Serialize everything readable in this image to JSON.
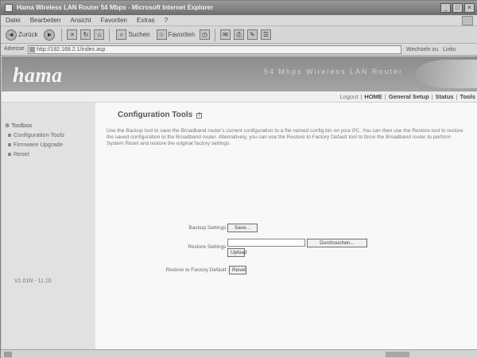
{
  "window": {
    "title": "Hama Wireless LAN Router 54 Mbps - Microsoft Internet Explorer",
    "controls": [
      "_",
      "□",
      "×"
    ]
  },
  "menu": [
    "Datei",
    "Bearbeiten",
    "Ansicht",
    "Favoriten",
    "Extras",
    "?"
  ],
  "toolbar": {
    "back_label": "Zurück",
    "search_label": "Suchen",
    "favorites_label": "Favoriten"
  },
  "address": {
    "label": "Adresse",
    "url": "http://192.168.2.1/index.asp",
    "go_label": "Wechseln zu",
    "links_label": "Links"
  },
  "banner": {
    "logo": "hama",
    "tagline": "54 Mbps Wireless LAN Router"
  },
  "topnav": {
    "logout": "Logout",
    "items": [
      "HOME",
      "General Setup",
      "Status",
      "Tools"
    ]
  },
  "sidebar": {
    "root": "Toolbox",
    "items": [
      {
        "label": "Configuration Tools"
      },
      {
        "label": "Firmware Upgrade"
      },
      {
        "label": "Reset"
      }
    ],
    "firmware": "V1.01N - 11.10"
  },
  "main": {
    "title": "Configuration Tools",
    "help": "?",
    "description": "Use the Backup tool to save the Broadband router's current configuration to a file named config.bin on your PC. You can then use the Restore tool to restore the saved configuration to the Broadband router. Alternatively, you can use the Restore to Factory Default tool to force the Broadband router to perform System Reset and restore the original factory settings.",
    "form": {
      "backup_label": "Backup Settings :",
      "backup_button": "Save...",
      "restore_label": "Restore Settings :",
      "browse_button": "Durchsuchen...",
      "upload_button": "Upload",
      "factory_label": "Restore to Factory Default :",
      "reset_button": "Reset"
    }
  },
  "colors": {
    "banner": "#8c8c8c",
    "sidebar": "#e1e1e1",
    "content": "#f8f8f8"
  }
}
